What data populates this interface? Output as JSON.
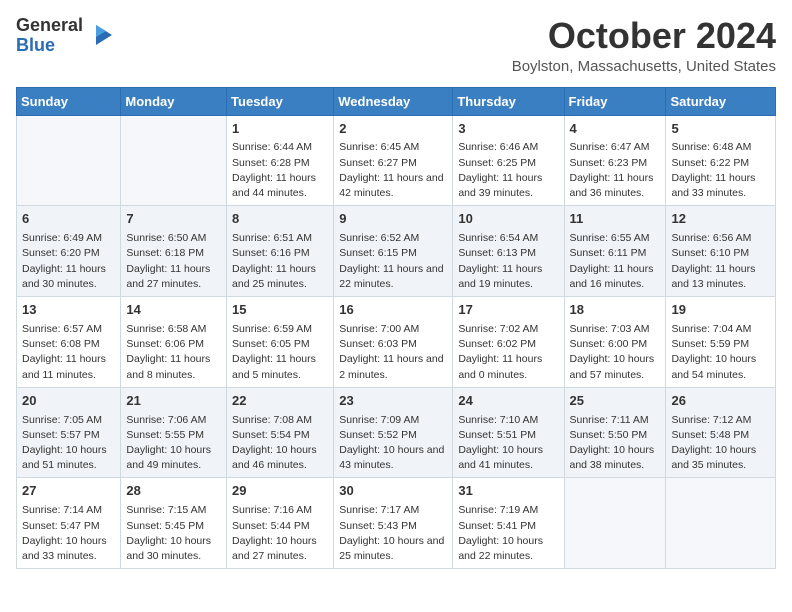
{
  "header": {
    "logo_general": "General",
    "logo_blue": "Blue",
    "month_title": "October 2024",
    "location": "Boylston, Massachusetts, United States"
  },
  "days_of_week": [
    "Sunday",
    "Monday",
    "Tuesday",
    "Wednesday",
    "Thursday",
    "Friday",
    "Saturday"
  ],
  "weeks": [
    [
      {
        "day": "",
        "sunrise": "",
        "sunset": "",
        "daylight": ""
      },
      {
        "day": "",
        "sunrise": "",
        "sunset": "",
        "daylight": ""
      },
      {
        "day": "1",
        "sunrise": "Sunrise: 6:44 AM",
        "sunset": "Sunset: 6:28 PM",
        "daylight": "Daylight: 11 hours and 44 minutes."
      },
      {
        "day": "2",
        "sunrise": "Sunrise: 6:45 AM",
        "sunset": "Sunset: 6:27 PM",
        "daylight": "Daylight: 11 hours and 42 minutes."
      },
      {
        "day": "3",
        "sunrise": "Sunrise: 6:46 AM",
        "sunset": "Sunset: 6:25 PM",
        "daylight": "Daylight: 11 hours and 39 minutes."
      },
      {
        "day": "4",
        "sunrise": "Sunrise: 6:47 AM",
        "sunset": "Sunset: 6:23 PM",
        "daylight": "Daylight: 11 hours and 36 minutes."
      },
      {
        "day": "5",
        "sunrise": "Sunrise: 6:48 AM",
        "sunset": "Sunset: 6:22 PM",
        "daylight": "Daylight: 11 hours and 33 minutes."
      }
    ],
    [
      {
        "day": "6",
        "sunrise": "Sunrise: 6:49 AM",
        "sunset": "Sunset: 6:20 PM",
        "daylight": "Daylight: 11 hours and 30 minutes."
      },
      {
        "day": "7",
        "sunrise": "Sunrise: 6:50 AM",
        "sunset": "Sunset: 6:18 PM",
        "daylight": "Daylight: 11 hours and 27 minutes."
      },
      {
        "day": "8",
        "sunrise": "Sunrise: 6:51 AM",
        "sunset": "Sunset: 6:16 PM",
        "daylight": "Daylight: 11 hours and 25 minutes."
      },
      {
        "day": "9",
        "sunrise": "Sunrise: 6:52 AM",
        "sunset": "Sunset: 6:15 PM",
        "daylight": "Daylight: 11 hours and 22 minutes."
      },
      {
        "day": "10",
        "sunrise": "Sunrise: 6:54 AM",
        "sunset": "Sunset: 6:13 PM",
        "daylight": "Daylight: 11 hours and 19 minutes."
      },
      {
        "day": "11",
        "sunrise": "Sunrise: 6:55 AM",
        "sunset": "Sunset: 6:11 PM",
        "daylight": "Daylight: 11 hours and 16 minutes."
      },
      {
        "day": "12",
        "sunrise": "Sunrise: 6:56 AM",
        "sunset": "Sunset: 6:10 PM",
        "daylight": "Daylight: 11 hours and 13 minutes."
      }
    ],
    [
      {
        "day": "13",
        "sunrise": "Sunrise: 6:57 AM",
        "sunset": "Sunset: 6:08 PM",
        "daylight": "Daylight: 11 hours and 11 minutes."
      },
      {
        "day": "14",
        "sunrise": "Sunrise: 6:58 AM",
        "sunset": "Sunset: 6:06 PM",
        "daylight": "Daylight: 11 hours and 8 minutes."
      },
      {
        "day": "15",
        "sunrise": "Sunrise: 6:59 AM",
        "sunset": "Sunset: 6:05 PM",
        "daylight": "Daylight: 11 hours and 5 minutes."
      },
      {
        "day": "16",
        "sunrise": "Sunrise: 7:00 AM",
        "sunset": "Sunset: 6:03 PM",
        "daylight": "Daylight: 11 hours and 2 minutes."
      },
      {
        "day": "17",
        "sunrise": "Sunrise: 7:02 AM",
        "sunset": "Sunset: 6:02 PM",
        "daylight": "Daylight: 11 hours and 0 minutes."
      },
      {
        "day": "18",
        "sunrise": "Sunrise: 7:03 AM",
        "sunset": "Sunset: 6:00 PM",
        "daylight": "Daylight: 10 hours and 57 minutes."
      },
      {
        "day": "19",
        "sunrise": "Sunrise: 7:04 AM",
        "sunset": "Sunset: 5:59 PM",
        "daylight": "Daylight: 10 hours and 54 minutes."
      }
    ],
    [
      {
        "day": "20",
        "sunrise": "Sunrise: 7:05 AM",
        "sunset": "Sunset: 5:57 PM",
        "daylight": "Daylight: 10 hours and 51 minutes."
      },
      {
        "day": "21",
        "sunrise": "Sunrise: 7:06 AM",
        "sunset": "Sunset: 5:55 PM",
        "daylight": "Daylight: 10 hours and 49 minutes."
      },
      {
        "day": "22",
        "sunrise": "Sunrise: 7:08 AM",
        "sunset": "Sunset: 5:54 PM",
        "daylight": "Daylight: 10 hours and 46 minutes."
      },
      {
        "day": "23",
        "sunrise": "Sunrise: 7:09 AM",
        "sunset": "Sunset: 5:52 PM",
        "daylight": "Daylight: 10 hours and 43 minutes."
      },
      {
        "day": "24",
        "sunrise": "Sunrise: 7:10 AM",
        "sunset": "Sunset: 5:51 PM",
        "daylight": "Daylight: 10 hours and 41 minutes."
      },
      {
        "day": "25",
        "sunrise": "Sunrise: 7:11 AM",
        "sunset": "Sunset: 5:50 PM",
        "daylight": "Daylight: 10 hours and 38 minutes."
      },
      {
        "day": "26",
        "sunrise": "Sunrise: 7:12 AM",
        "sunset": "Sunset: 5:48 PM",
        "daylight": "Daylight: 10 hours and 35 minutes."
      }
    ],
    [
      {
        "day": "27",
        "sunrise": "Sunrise: 7:14 AM",
        "sunset": "Sunset: 5:47 PM",
        "daylight": "Daylight: 10 hours and 33 minutes."
      },
      {
        "day": "28",
        "sunrise": "Sunrise: 7:15 AM",
        "sunset": "Sunset: 5:45 PM",
        "daylight": "Daylight: 10 hours and 30 minutes."
      },
      {
        "day": "29",
        "sunrise": "Sunrise: 7:16 AM",
        "sunset": "Sunset: 5:44 PM",
        "daylight": "Daylight: 10 hours and 27 minutes."
      },
      {
        "day": "30",
        "sunrise": "Sunrise: 7:17 AM",
        "sunset": "Sunset: 5:43 PM",
        "daylight": "Daylight: 10 hours and 25 minutes."
      },
      {
        "day": "31",
        "sunrise": "Sunrise: 7:19 AM",
        "sunset": "Sunset: 5:41 PM",
        "daylight": "Daylight: 10 hours and 22 minutes."
      },
      {
        "day": "",
        "sunrise": "",
        "sunset": "",
        "daylight": ""
      },
      {
        "day": "",
        "sunrise": "",
        "sunset": "",
        "daylight": ""
      }
    ]
  ]
}
